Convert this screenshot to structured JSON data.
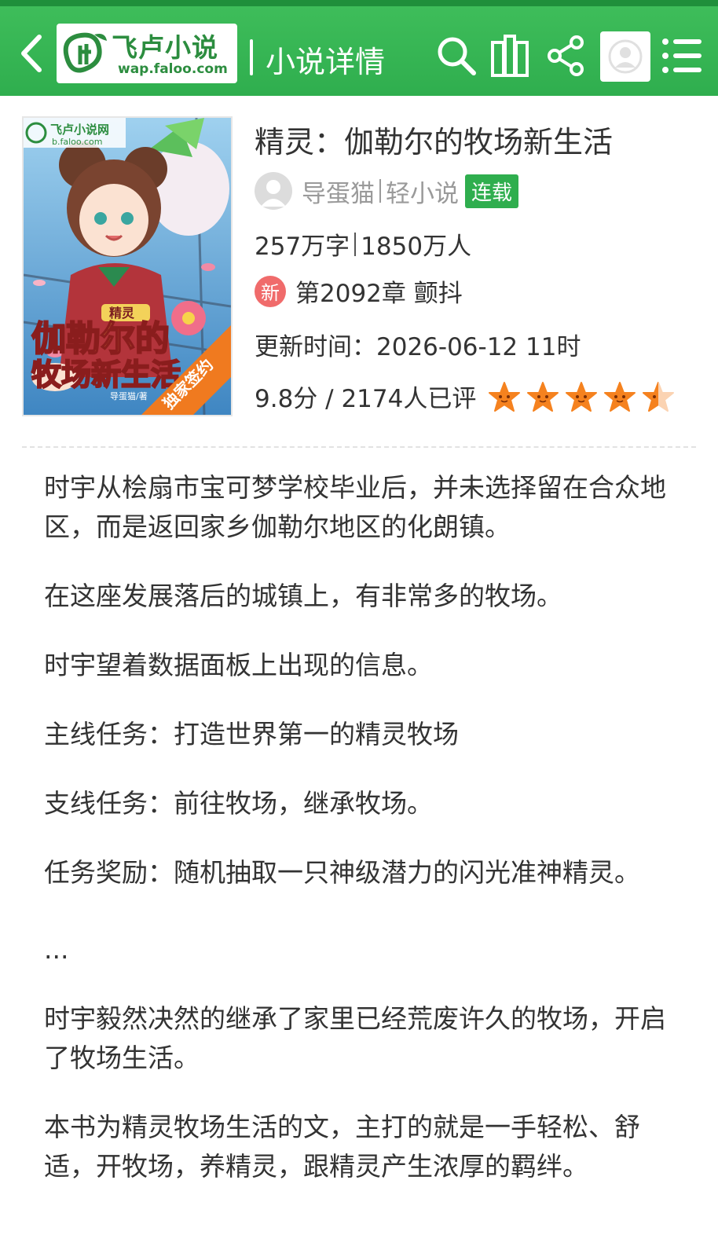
{
  "header": {
    "logo_title": "飞卢小说",
    "logo_url": "wap.faloo.com",
    "title": "小说详情"
  },
  "cover": {
    "site_label": "飞卢小说网",
    "site_url": "b.faloo.com",
    "tag": "精灵",
    "title_line1": "伽勒尔的",
    "title_line2": "牧场新生活",
    "author_credit": "导蛋猫/著",
    "ribbon": "独家签约"
  },
  "book": {
    "title": "精灵：伽勒尔的牧场新生活",
    "author": "导蛋猫",
    "category": "轻小说",
    "status": "连载",
    "word_count": "257万字",
    "readers": "1850万人",
    "new_badge": "新",
    "latest_chapter": "第2092章 颤抖",
    "update_time": "更新时间：2026-06-12 11时",
    "rating_text": "9.8分 / 2174人已评",
    "stars": 4.5
  },
  "description": [
    "时宇从桧扇市宝可梦学校毕业后，并未选择留在合众地区，而是返回家乡伽勒尔地区的化朗镇。",
    "在这座发展落后的城镇上，有非常多的牧场。",
    "时宇望着数据面板上出现的信息。",
    "主线任务：打造世界第一的精灵牧场",
    "支线任务：前往牧场，继承牧场。",
    "任务奖励：随机抽取一只神级潜力的闪光准神精灵。",
    "...",
    "时宇毅然决然的继承了家里已经荒废许久的牧场，开启了牧场生活。",
    "本书为精灵牧场生活的文，主打的就是一手轻松、舒适，开牧场，养精灵，跟精灵产生浓厚的羁绊。"
  ],
  "colors": {
    "header_green": "#2fae4e",
    "status_green": "#2fae4e",
    "star_orange": "#f5821f",
    "new_red": "#f06b6b"
  }
}
